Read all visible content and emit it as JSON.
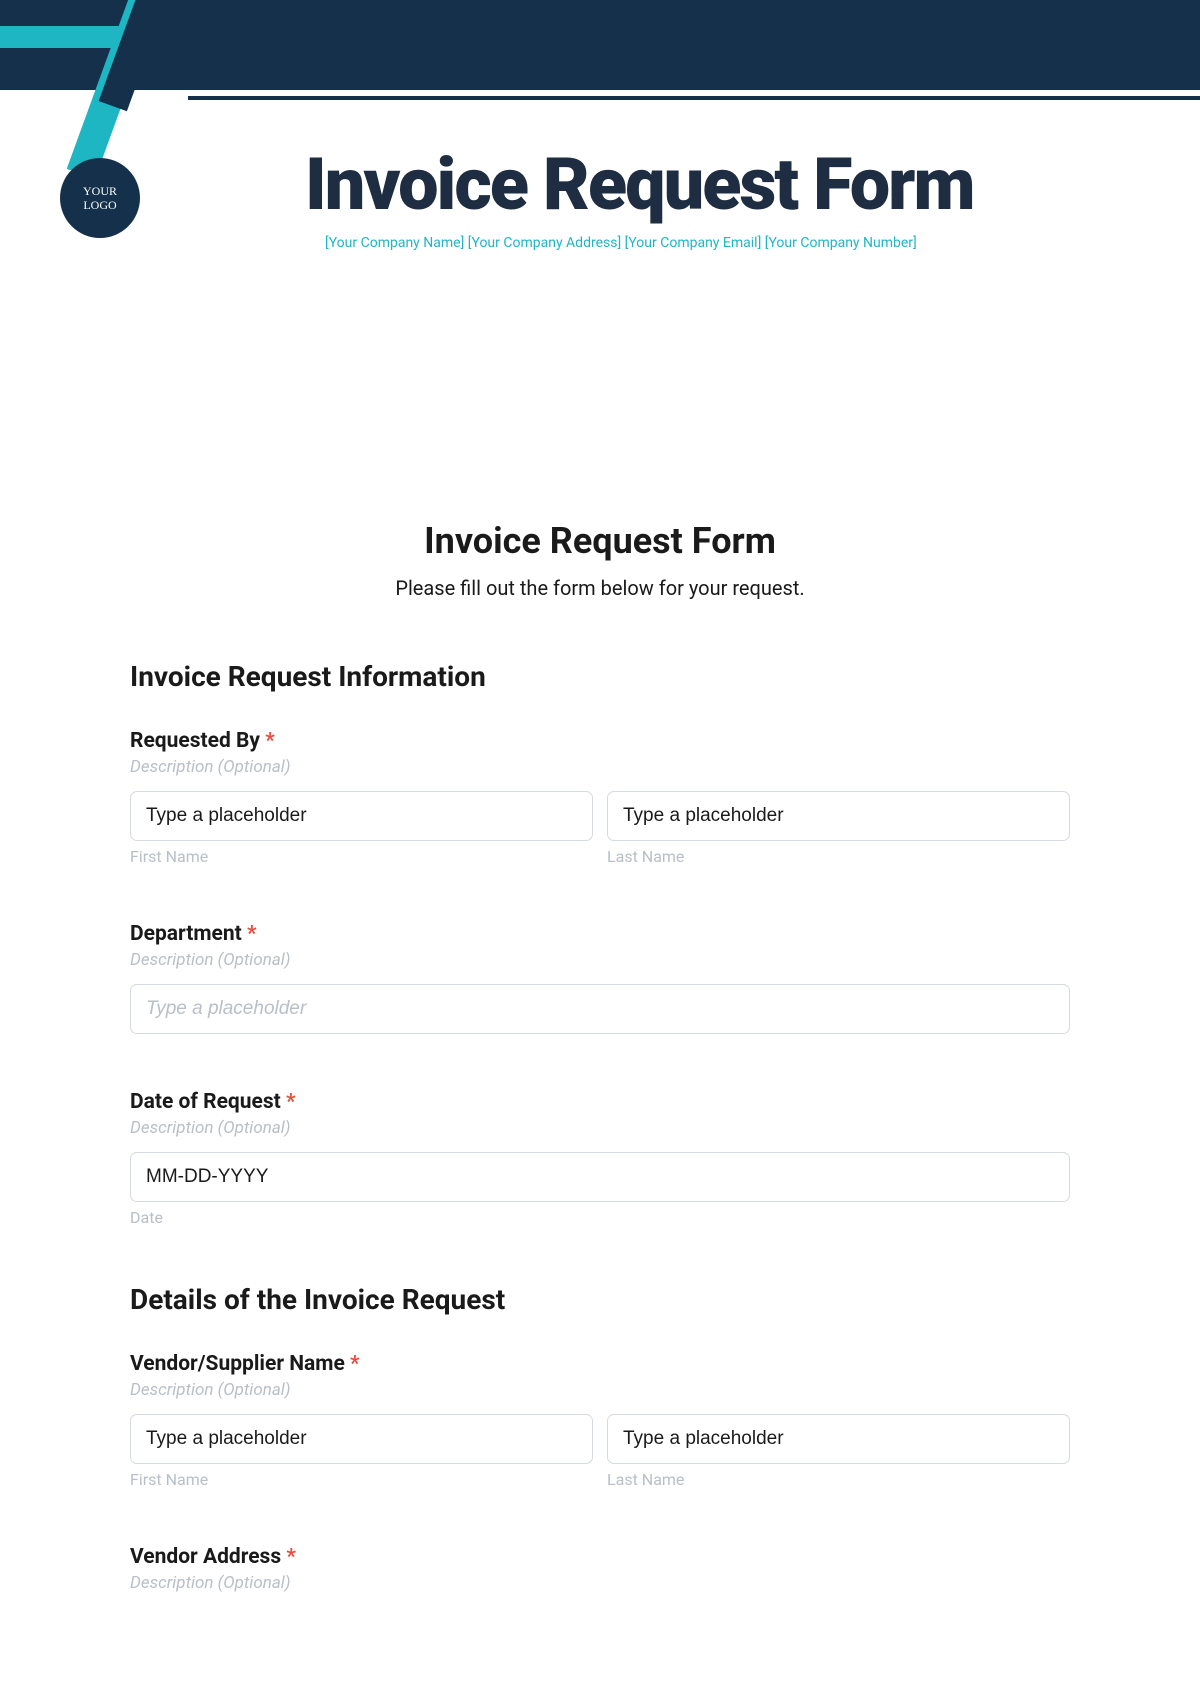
{
  "banner": {
    "logo_line1": "YOUR",
    "logo_line2": "LOGO",
    "title": "Invoice Request Form",
    "subtitle": "[Your Company Name] [Your Company Address] [Your Company Email] [Your Company Number]"
  },
  "form": {
    "title": "Invoice Request Form",
    "intro": "Please fill out the form below for your request.",
    "section1_heading": "Invoice Request Information",
    "requested_by": {
      "label": "Requested By",
      "desc": "Description (Optional)",
      "first_ph": "Type a placeholder",
      "last_ph": "Type a placeholder",
      "first_sub": "First Name",
      "last_sub": "Last Name"
    },
    "department": {
      "label": "Department",
      "desc": "Description (Optional)",
      "ph": "Type a placeholder"
    },
    "date": {
      "label": "Date of Request",
      "desc": "Description (Optional)",
      "ph": "MM-DD-YYYY",
      "sub": "Date"
    },
    "section2_heading": "Details of the Invoice Request",
    "vendor_name": {
      "label": "Vendor/Supplier Name",
      "desc": "Description (Optional)",
      "first_ph": "Type a placeholder",
      "last_ph": "Type a placeholder",
      "first_sub": "First Name",
      "last_sub": "Last Name"
    },
    "vendor_address": {
      "label": "Vendor Address",
      "desc": "Description (Optional)"
    },
    "required_marker": "*"
  }
}
